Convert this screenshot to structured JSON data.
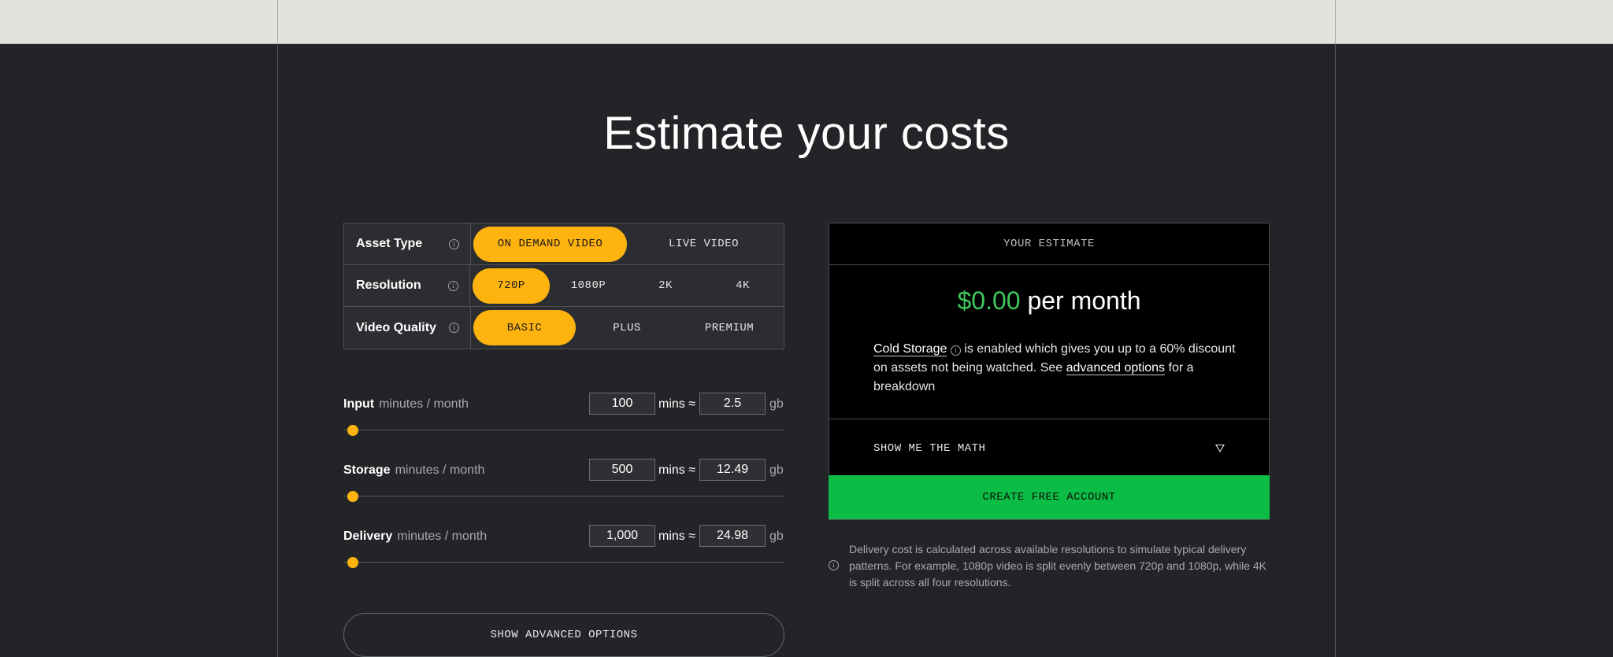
{
  "page": {
    "title": "Estimate your costs"
  },
  "options": {
    "asset_type": {
      "label": "Asset Type",
      "choices": [
        "ON DEMAND VIDEO",
        "LIVE VIDEO"
      ],
      "selected": "ON DEMAND VIDEO"
    },
    "resolution": {
      "label": "Resolution",
      "choices": [
        "720P",
        "1080P",
        "2K",
        "4K"
      ],
      "selected": "720P"
    },
    "video_quality": {
      "label": "Video Quality",
      "choices": [
        "BASIC",
        "PLUS",
        "PREMIUM"
      ],
      "selected": "BASIC"
    }
  },
  "sliders": {
    "input": {
      "label": "Input",
      "sublabel": "minutes / month",
      "mins": "100",
      "mins_unit": "mins ≈",
      "gb": "2.5",
      "gb_unit": "gb",
      "level": 0.01
    },
    "storage": {
      "label": "Storage",
      "sublabel": "minutes / month",
      "mins": "500",
      "mins_unit": "mins ≈",
      "gb": "12.49",
      "gb_unit": "gb",
      "level": 0.01
    },
    "delivery": {
      "label": "Delivery",
      "sublabel": "minutes / month",
      "mins": "1,000",
      "mins_unit": "mins ≈",
      "gb": "24.98",
      "gb_unit": "gb",
      "level": 0.01
    }
  },
  "advanced_button": "SHOW ADVANCED OPTIONS",
  "estimate": {
    "header": "YOUR ESTIMATE",
    "amount": "$0.00",
    "period": "per month",
    "cold_storage": "Cold Storage",
    "note_part1": "is enabled which gives you up to a 60% discount on assets not being watched. See",
    "advanced_link": "advanced options",
    "note_part2": "for a breakdown",
    "math_toggle": "SHOW ME THE MATH"
  },
  "create_button": "CREATE FREE ACCOUNT",
  "footnote": "Delivery cost is calculated across available resolutions to simulate typical delivery patterns. For example, 1080p video is split evenly between 720p and 1080p, while 4K is split across all four resolutions.",
  "colors": {
    "accent": "#ffb30f",
    "green": "#0cbd45",
    "price_green": "#3ec95a",
    "background": "#232427"
  },
  "icons": {
    "info": "info-icon",
    "toggle": "triangle-down-icon"
  }
}
